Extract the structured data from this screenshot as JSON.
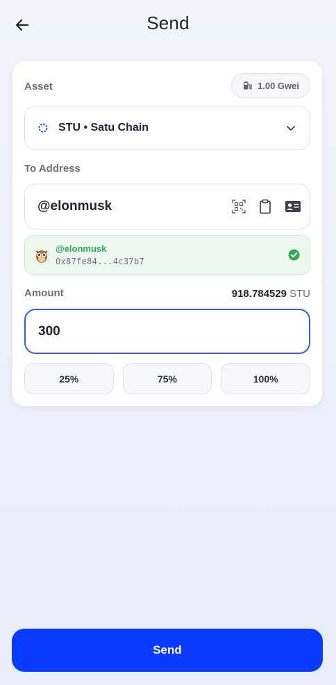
{
  "header": {
    "title": "Send"
  },
  "asset": {
    "label": "Asset",
    "gas_fee": "1.00 Gwei",
    "selected": "STU • Satu Chain"
  },
  "to_address": {
    "label": "To Address",
    "value": "@elonmusk",
    "resolved_name": "@elonmusk",
    "resolved_address": "0x87fe84...4c37b7"
  },
  "amount": {
    "label": "Amount",
    "balance": "918.784529",
    "balance_unit": "STU",
    "value": "300",
    "presets": [
      "25%",
      "75%",
      "100%"
    ]
  },
  "footer": {
    "send_label": "Send"
  },
  "colors": {
    "primary": "#0a3cff",
    "input_focus": "#3b5bd9",
    "success": "#2fa84f",
    "success_bg": "#ecf8ef"
  },
  "icons": {
    "back": "arrow-left-icon",
    "gas": "gas-pump-icon",
    "chain": "ring-icon",
    "dropdown": "chevron-down-icon",
    "scan": "qr-scan-icon",
    "paste": "clipboard-icon",
    "contacts": "contact-card-icon",
    "verified": "check-circle-icon",
    "avatar": "owl-icon"
  }
}
